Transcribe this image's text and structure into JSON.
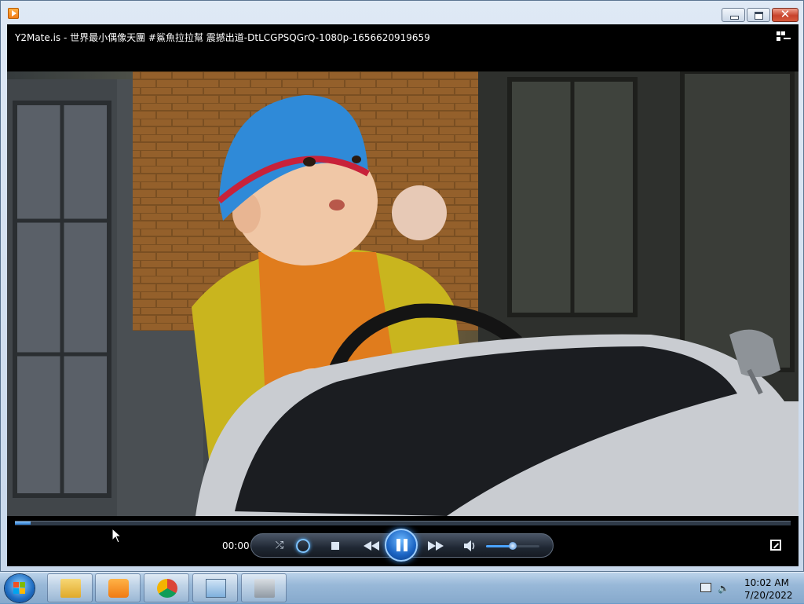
{
  "window": {
    "title_icon": "media-player-icon",
    "controls": [
      "minimize",
      "maximize",
      "close"
    ]
  },
  "player": {
    "media_title": "Y2Mate.is - 世界最小偶像天團 #鯊魚拉拉幫 震撼出道-DtLCGPSQGrQ-1080p-1656620919659",
    "time_elapsed": "00:00",
    "seek_progress": 0.02,
    "volume_level": 0.5,
    "state": "playing",
    "icons": {
      "switch_to_library": "switch-library-icon",
      "shuffle": "shuffle-icon",
      "repeat": "repeat-icon",
      "stop": "stop-icon",
      "previous": "previous-icon",
      "play_pause": "pause-icon",
      "next": "next-icon",
      "mute": "speaker-icon",
      "fullscreen": "fullscreen-icon"
    }
  },
  "taskbar": {
    "items": [
      {
        "name": "start-button",
        "icon": "windows-logo-icon"
      },
      {
        "name": "windows-explorer",
        "icon": "folder-icon"
      },
      {
        "name": "windows-media-player",
        "icon": "media-player-icon"
      },
      {
        "name": "google-chrome",
        "icon": "chrome-icon"
      },
      {
        "name": "control-panel",
        "icon": "control-panel-icon"
      },
      {
        "name": "installer",
        "icon": "installer-icon"
      }
    ],
    "tray": {
      "time": "10:02 AM",
      "date": "7/20/2022",
      "icons": [
        "network-icon",
        "volume-icon"
      ]
    }
  },
  "colors": {
    "player_background": "#000000",
    "accent": "#2d79c9",
    "taskbar": "#98b8d8",
    "close_button": "#c8432c"
  }
}
